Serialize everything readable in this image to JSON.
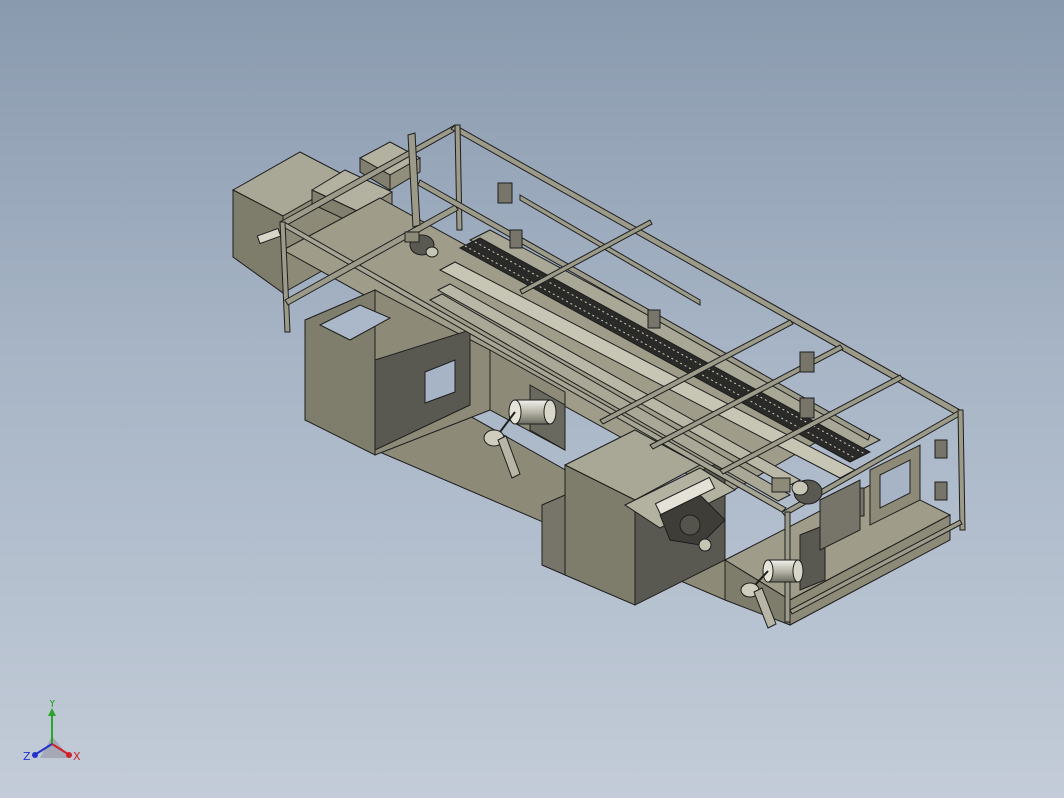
{
  "viewport": {
    "background_top": "#8a9aae",
    "background_bottom": "#c3ccd8"
  },
  "model": {
    "face_color": "#8d8b78",
    "dark_face_color": "#55544c",
    "edge_color": "#1e1e1e",
    "frame_color": "#9c9a88"
  },
  "triad": {
    "y_label": "Y",
    "z_label": "Z",
    "x_label": "X",
    "y_color": "#2aa52a",
    "z_color": "#2233cc",
    "x_color": "#d0202a"
  }
}
